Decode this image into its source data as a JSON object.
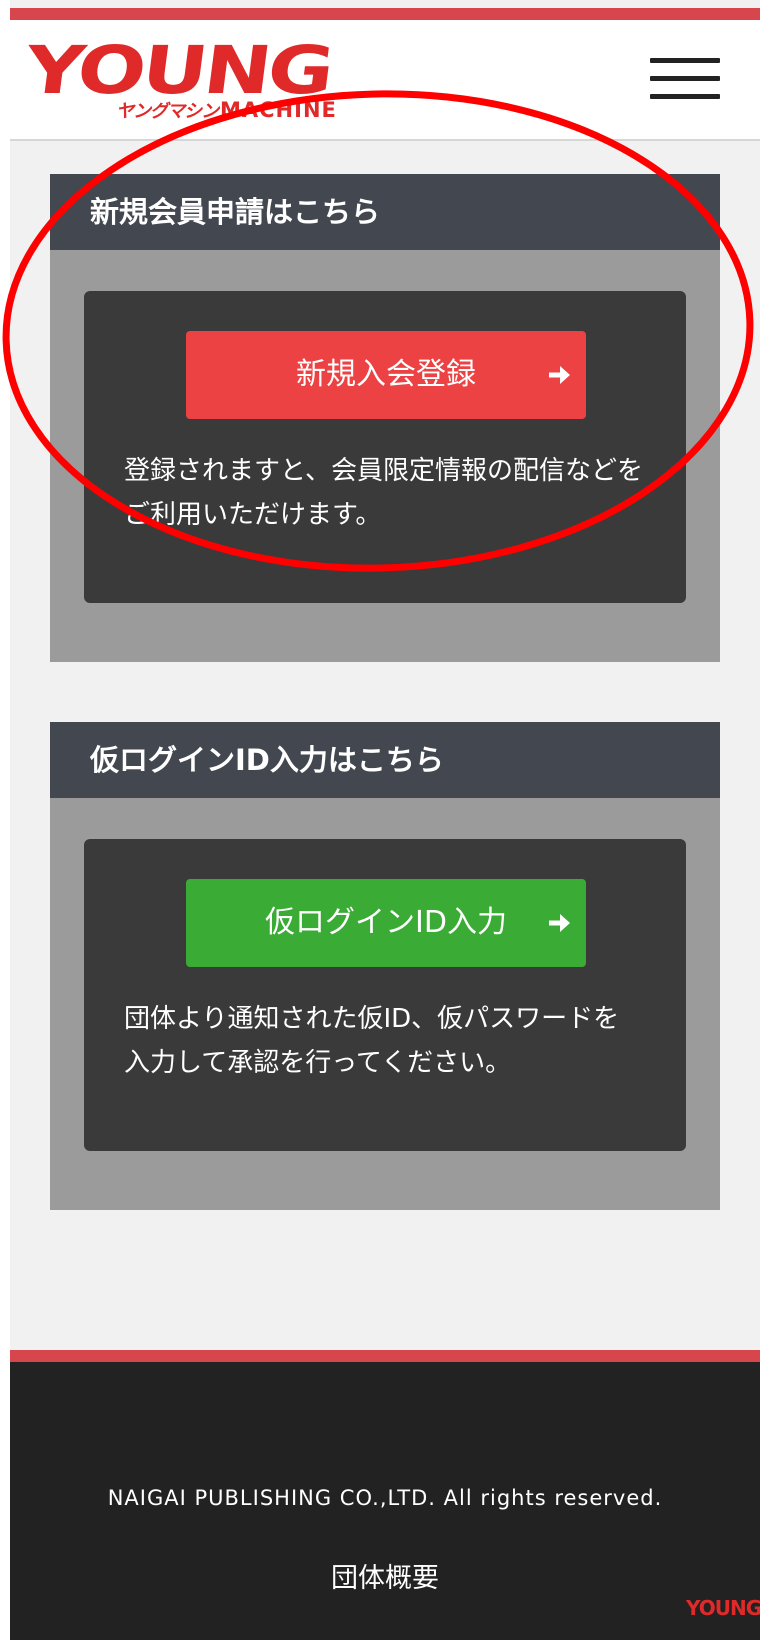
{
  "header": {
    "logo_main": "YOUNG",
    "logo_sub_kana": "ヤングマシン",
    "logo_sub_word": "MACHINE",
    "menu_icon": "hamburger-menu-icon"
  },
  "signup": {
    "heading": "新規会員申請はこちら",
    "button_label": "新規入会登録",
    "button_icon": "arrow-right-icon",
    "description": "登録されますと、会員限定情報の配信などをご利用いただけます。"
  },
  "temp_login": {
    "heading": "仮ログインID入力はこちら",
    "button_label": "仮ログインID入力",
    "button_icon": "arrow-right-icon",
    "description": "団体より通知された仮ID、仮パスワードを入力して承認を行ってください。"
  },
  "footer": {
    "copyright": "NAIGAI PUBLISHING CO.,LTD. All rights reserved.",
    "link_about": "団体概要",
    "logo_small": "YOUNG"
  },
  "colors": {
    "brand_red": "#e02a2a",
    "stripe_red": "#d8464d",
    "panel_header": "#434750",
    "signup_button": "#ec4244",
    "login_button": "#3aab34",
    "annotation": "#ff0000"
  }
}
